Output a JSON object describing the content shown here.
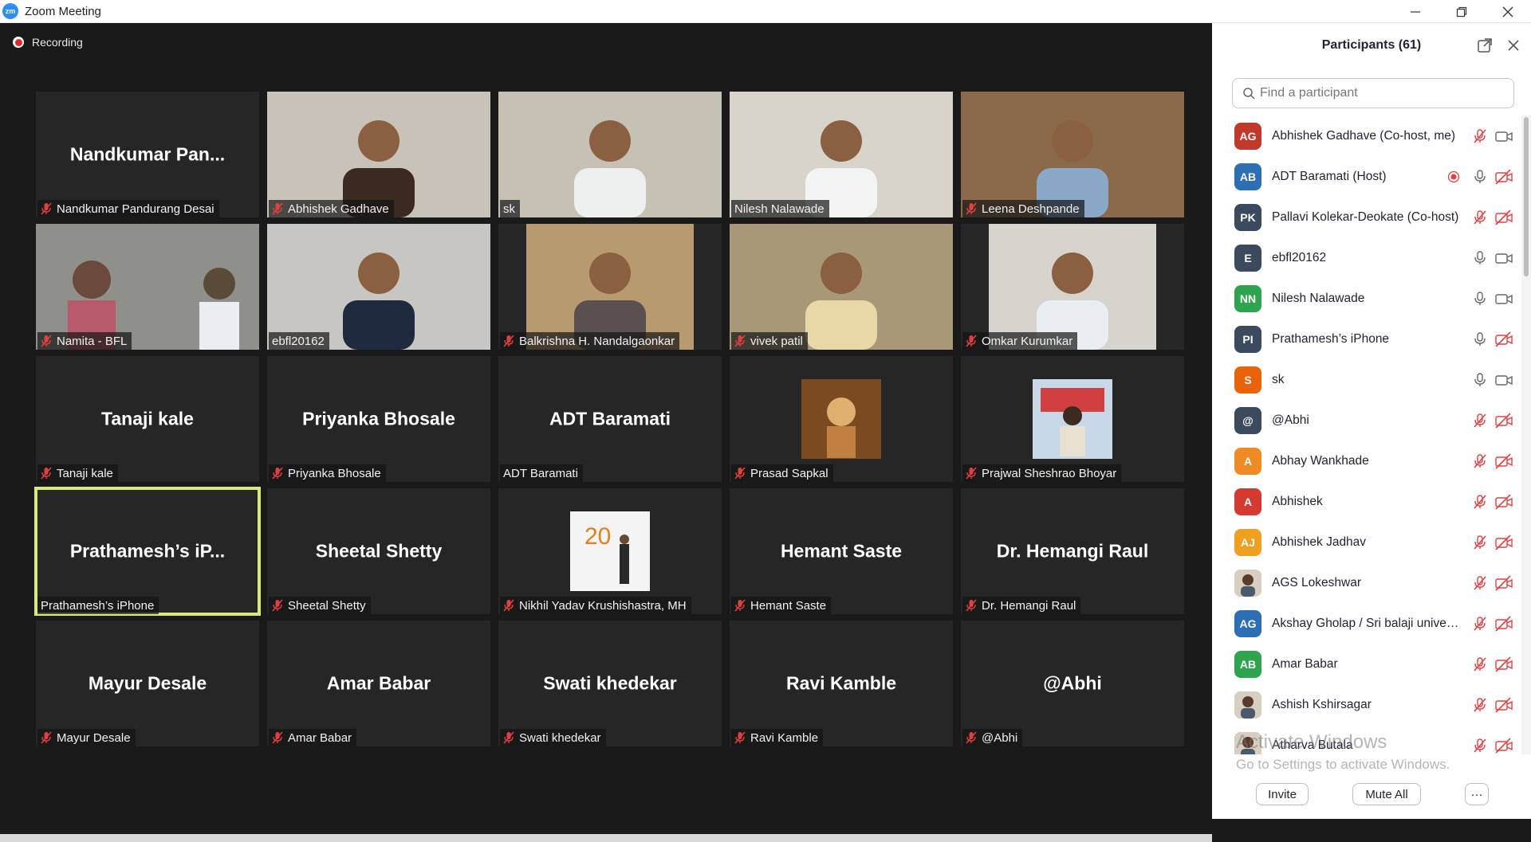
{
  "window": {
    "title": "Zoom Meeting",
    "app_icon": "zm"
  },
  "recording": {
    "label": "Recording"
  },
  "tiles": [
    {
      "big": "Nandkumar Pan...",
      "name": "Nandkumar Pandurang Desai",
      "muted": true
    },
    {
      "big": "",
      "name": "Abhishek Gadhave",
      "muted": true
    },
    {
      "big": "",
      "name": "sk",
      "muted": false
    },
    {
      "big": "",
      "name": "Nilesh Nalawade",
      "muted": false
    },
    {
      "big": "",
      "name": "Leena Deshpande",
      "muted": true
    },
    {
      "big": "",
      "name": "Namita - BFL",
      "muted": true
    },
    {
      "big": "",
      "name": "ebfl20162",
      "muted": false
    },
    {
      "big": "",
      "name": "Balkrishna H. Nandalgaonkar",
      "muted": true
    },
    {
      "big": "",
      "name": "vivek patil",
      "muted": true
    },
    {
      "big": "",
      "name": "Omkar Kurumkar",
      "muted": true
    },
    {
      "big": "Tanaji kale",
      "name": "Tanaji kale",
      "muted": true
    },
    {
      "big": "Priyanka Bhosale",
      "name": "Priyanka Bhosale",
      "muted": true
    },
    {
      "big": "ADT Baramati",
      "name": "ADT Baramati",
      "muted": false
    },
    {
      "big": "",
      "name": "Prasad Sapkal",
      "muted": true
    },
    {
      "big": "",
      "name": "Prajwal  Sheshrao Bhoyar",
      "muted": true
    },
    {
      "big": "Prathamesh’s  iP...",
      "name": "Prathamesh’s iPhone",
      "muted": false
    },
    {
      "big": "Sheetal Shetty",
      "name": "Sheetal Shetty",
      "muted": true
    },
    {
      "big": "",
      "name": "Nikhil Yadav Krushishastra, MH",
      "muted": true
    },
    {
      "big": "Hemant Saste",
      "name": "Hemant Saste",
      "muted": true
    },
    {
      "big": "Dr. Hemangi Raul",
      "name": "Dr. Hemangi Raul",
      "muted": true
    },
    {
      "big": "Mayur Desale",
      "name": "Mayur Desale",
      "muted": true
    },
    {
      "big": "Amar Babar",
      "name": "Amar Babar",
      "muted": true
    },
    {
      "big": "Swati khedekar",
      "name": "Swati khedekar",
      "muted": true
    },
    {
      "big": "Ravi Kamble",
      "name": "Ravi Kamble",
      "muted": true
    },
    {
      "big": "@Abhi",
      "name": "@Abhi",
      "muted": true
    }
  ],
  "panel": {
    "title": "Participants (61)",
    "search_placeholder": "Find a participant",
    "participants": [
      {
        "initials": "AG",
        "color": "#c0392b",
        "name": "Abhishek Gadhave (Co-host, me)",
        "mic": "off",
        "cam": "on"
      },
      {
        "initials": "AB",
        "color": "#2d6fb5",
        "name": "ADT Baramati (Host)",
        "mic": "on",
        "cam": "off",
        "recording": true
      },
      {
        "initials": "PK",
        "color": "#3b4a5c",
        "name": "Pallavi Kolekar-Deokate (Co-host)",
        "mic": "off",
        "cam": "off"
      },
      {
        "initials": "E",
        "color": "#3b4a5c",
        "name": "ebfl20162",
        "mic": "on",
        "cam": "on"
      },
      {
        "initials": "NN",
        "color": "#2ea44f",
        "name": "Nilesh Nalawade",
        "mic": "on",
        "cam": "on"
      },
      {
        "initials": "PI",
        "color": "#3b4a5c",
        "name": "Prathamesh’s iPhone",
        "mic": "on",
        "cam": "off"
      },
      {
        "initials": "S",
        "color": "#e8630a",
        "name": "sk",
        "mic": "on",
        "cam": "on"
      },
      {
        "initials": "@",
        "color": "#3b4a5c",
        "name": "@Abhi",
        "mic": "off",
        "cam": "off"
      },
      {
        "initials": "A",
        "color": "#f08a24",
        "name": "Abhay Wankhade",
        "mic": "off",
        "cam": "off"
      },
      {
        "initials": "A",
        "color": "#d43a2f",
        "name": "Abhishek",
        "mic": "off",
        "cam": "off"
      },
      {
        "initials": "AJ",
        "color": "#f0a020",
        "name": "Abhishek Jadhav",
        "mic": "off",
        "cam": "off"
      },
      {
        "initials": "",
        "color": "#7a6a5a",
        "name": "AGS Lokeshwar",
        "mic": "off",
        "cam": "off",
        "photo": true
      },
      {
        "initials": "AG",
        "color": "#2d6fb5",
        "name": "Akshay Gholap / Sri balaji univer...",
        "mic": "off",
        "cam": "off"
      },
      {
        "initials": "AB",
        "color": "#2ea44f",
        "name": "Amar Babar",
        "mic": "off",
        "cam": "off"
      },
      {
        "initials": "",
        "color": "#8a7a6a",
        "name": "Ashish Kshirsagar",
        "mic": "off",
        "cam": "off",
        "photo": true
      },
      {
        "initials": "",
        "color": "#555555",
        "name": "Atharva Butala",
        "mic": "off",
        "cam": "off",
        "photo": true
      }
    ],
    "invite_label": "Invite",
    "mute_all_label": "Mute All",
    "more_label": "···"
  },
  "watermark": {
    "line1": "Activate Windows",
    "line2": "Go to Settings to activate Windows."
  }
}
